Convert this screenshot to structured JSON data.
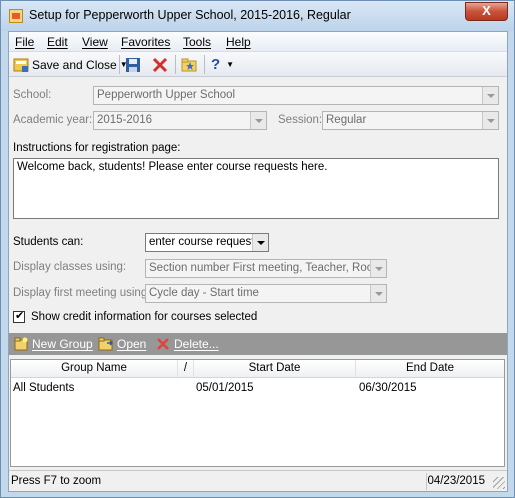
{
  "window": {
    "title": "Setup for Pepperworth Upper School, 2015-2016, Regular",
    "close_glyph": "X"
  },
  "menu": [
    "File",
    "Edit",
    "View",
    "Favorites",
    "Tools",
    "Help"
  ],
  "toolbar": {
    "save_close_label": "Save and Close",
    "help_glyph": "?"
  },
  "form": {
    "school_label": "School:",
    "school_value": "Pepperworth Upper School",
    "academic_year_label": "Academic year:",
    "academic_year_value": "2015-2016",
    "session_label": "Session:",
    "session_value": "Regular",
    "instructions_label": "Instructions for registration page:",
    "instructions_value": "Welcome back, students! Please enter course requests here.",
    "students_can_label": "Students can:",
    "students_can_value": "enter course requests",
    "display_classes_label": "Display classes using:",
    "display_classes_value": "Section number  First meeting, Teacher, Room",
    "display_first_meeting_label": "Display first meeting using:",
    "display_first_meeting_value": "Cycle day - Start time",
    "show_credit_label": "Show credit information for courses selected",
    "show_credit_checked": true
  },
  "grid_toolbar": {
    "new_group": "New Group",
    "open": "Open",
    "delete": "Delete..."
  },
  "grid": {
    "columns": [
      "Group Name",
      "/",
      "Start Date",
      "End Date"
    ],
    "rows": [
      {
        "group_name": "All  Students",
        "start_date": "05/01/2015",
        "end_date": "06/30/2015"
      }
    ]
  },
  "status": {
    "hint": "Press F7 to zoom",
    "date": "04/23/2015"
  },
  "colors": {
    "titlebar": "#c4d8ec",
    "grid_toolbar": "#979797",
    "close_button": "#c9523a"
  }
}
